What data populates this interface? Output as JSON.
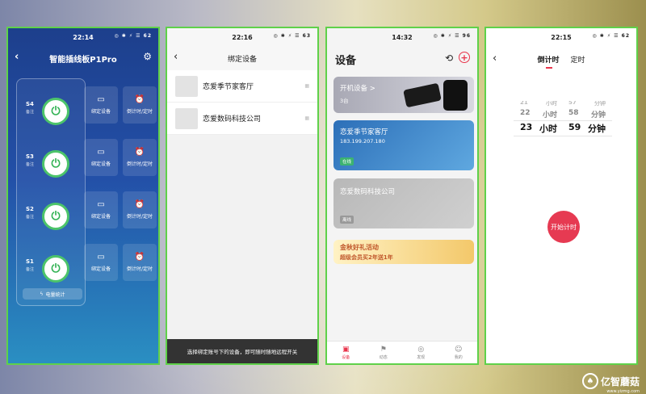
{
  "phone1": {
    "time": "22:14",
    "status": "◎ ✱ ⚡ ☰ 62",
    "title": "智能插线板P1Pro",
    "sockets": [
      {
        "label": "S4",
        "sub": "备注"
      },
      {
        "label": "S3",
        "sub": "备注"
      },
      {
        "label": "S2",
        "sub": "备注"
      },
      {
        "label": "S1",
        "sub": "备注"
      }
    ],
    "bind_label": "绑定设备",
    "timer_label": "倒计时/定时",
    "energy": "电量统计",
    "power_symbol": "⏻"
  },
  "phone2": {
    "time": "22:16",
    "status": "◎ ✱ ⚡ ☰ 63",
    "title": "绑定设备",
    "devices": [
      "恋爱季节家客厅",
      "恋爱数码科技公司"
    ],
    "footer": "选择绑定账号下的设备，即可随时随地远程开关"
  },
  "phone3": {
    "time": "14:32",
    "status": "◎ ✱ ⚡ ☰ 96",
    "title": "设备",
    "card1": {
      "title": "开机设备 >",
      "count": "3台"
    },
    "card2": {
      "title": "恋爱季节家客厅",
      "ip": "183.199.207.180",
      "badge": "在线"
    },
    "card3": {
      "title": "恋爱数码科技公司",
      "badge": "离线"
    },
    "banner": {
      "line1": "金秋好礼活动",
      "line2": "超级会员买2年送1年"
    },
    "tabs": [
      "设备",
      "动态",
      "发现",
      "我的"
    ]
  },
  "phone4": {
    "time": "22:15",
    "status": "◎ ✱ ⚡ ☰ 62",
    "tab_countdown": "倒计时",
    "tab_timer": "定时",
    "picker": {
      "hours_prev2": "21",
      "hours_prev": "22",
      "hours_sel": "23",
      "minutes_prev2": "57",
      "minutes_prev": "58",
      "minutes_sel": "59",
      "hour_unit": "小时",
      "minute_unit": "分钟"
    },
    "start": "开始计时"
  },
  "watermark": {
    "name": "亿智蘑菇",
    "url": "www.yizmg.com"
  },
  "colors": {
    "accent": "#e8334a",
    "power_green": "#4cc46a",
    "online": "#3cb371"
  }
}
